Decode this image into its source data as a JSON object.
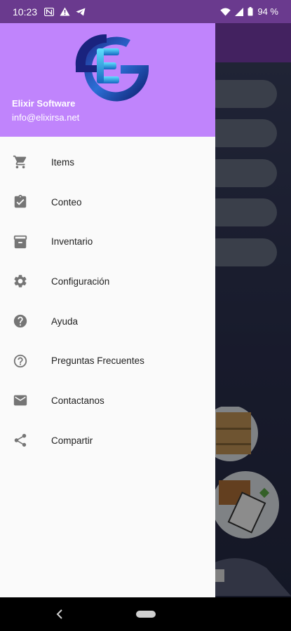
{
  "status_bar": {
    "time": "10:23",
    "battery": "94 %",
    "icons": [
      "notification-n-icon",
      "warning-icon",
      "telegram-icon",
      "wifi-icon",
      "signal-icon",
      "battery-icon"
    ]
  },
  "drawer": {
    "header_color": "#c084fc",
    "company": "Elixir Software",
    "email": "info@elixirsa.net",
    "items": [
      {
        "label": "Items",
        "icon": "cart-icon"
      },
      {
        "label": "Conteo",
        "icon": "clipboard-check-icon"
      },
      {
        "label": "Inventario",
        "icon": "archive-icon"
      },
      {
        "label": "Configuración",
        "icon": "gear-icon"
      },
      {
        "label": "Ayuda",
        "icon": "help-icon"
      },
      {
        "label": "Preguntas Frecuentes",
        "icon": "help-outline-icon"
      },
      {
        "label": "Contactanos",
        "icon": "mail-icon"
      },
      {
        "label": "Compartir",
        "icon": "share-icon"
      }
    ]
  },
  "colors": {
    "status_bar": "#6a3a8e",
    "app_bar": "#7b3fb0",
    "icon": "#757575"
  }
}
